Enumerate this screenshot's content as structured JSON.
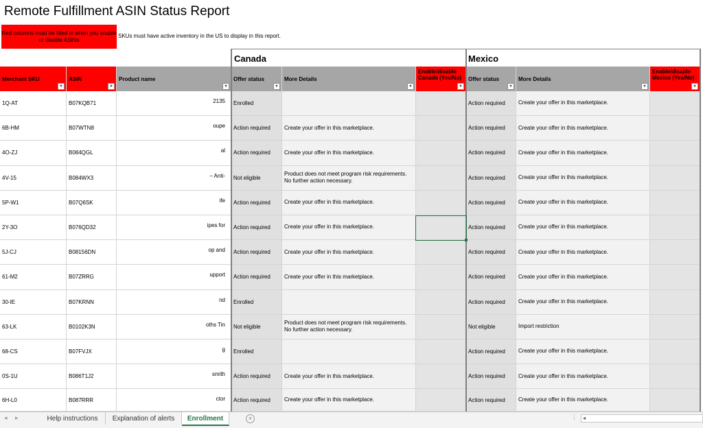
{
  "report": {
    "title": "Remote Fulfillment ASIN Status Report",
    "red_note": "Red columns must be filled in when you enable or disable ASINs",
    "note": "SKUs must have active inventory in the US to display in this report."
  },
  "sections": {
    "canada": "Canada",
    "mexico": "Mexico"
  },
  "headers": {
    "merchant_sku": "Merchant SKU",
    "asin": "ASIN",
    "product_name": "Product name",
    "ca_offer_status": "Offer status",
    "ca_more_details": "More Details",
    "ca_enable": "Enable/disable Canada (Yes/No)",
    "mx_offer_status": "Offer status",
    "mx_more_details": "More Details",
    "mx_enable": "Enable/disable Mexico (Yes/No)"
  },
  "dropdown_glyph": "▾",
  "rows": [
    {
      "sku": "1Q-AT",
      "asin": "B07KQB71",
      "name": "2135",
      "ca_status": "Enrolled",
      "ca_details": "",
      "mx_status": "Action required",
      "mx_details": "Create your offer in this marketplace."
    },
    {
      "sku": "6B-HM",
      "asin": "B07WTN8",
      "name": "oupe",
      "ca_status": "Action required",
      "ca_details": "Create your offer in this marketplace.",
      "mx_status": "Action required",
      "mx_details": "Create your offer in this marketplace."
    },
    {
      "sku": "4O-ZJ",
      "asin": "B084QGL",
      "name": "al",
      "ca_status": "Action required",
      "ca_details": "Create your offer in this marketplace.",
      "mx_status": "Action required",
      "mx_details": "Create your offer in this marketplace."
    },
    {
      "sku": "4V-15",
      "asin": "B084WX3",
      "name": "– Anti-",
      "ca_status": "Not eligible",
      "ca_details": "Product does not meet program risk requirements. No further action necessary.",
      "mx_status": "Action required",
      "mx_details": "Create your offer in this marketplace."
    },
    {
      "sku": "5P-W1",
      "asin": "B07Q6SK",
      "name": "ife",
      "ca_status": "Action required",
      "ca_details": "Create your offer in this marketplace.",
      "mx_status": "Action required",
      "mx_details": "Create your offer in this marketplace."
    },
    {
      "sku": "2Y-3O",
      "asin": "B076QD32",
      "name": "ipes for",
      "ca_status": "Action required",
      "ca_details": "Create your offer in this marketplace.",
      "mx_status": "Action required",
      "mx_details": "Create your offer in this marketplace."
    },
    {
      "sku": "5J-CJ",
      "asin": "B08156DN",
      "name": "op and",
      "ca_status": "Action required",
      "ca_details": "Create your offer in this marketplace.",
      "mx_status": "Action required",
      "mx_details": "Create your offer in this marketplace."
    },
    {
      "sku": "61-M2",
      "asin": "B07ZRRG",
      "name": "upport",
      "ca_status": "Action required",
      "ca_details": "Create your offer in this marketplace.",
      "mx_status": "Action required",
      "mx_details": "Create your offer in this marketplace."
    },
    {
      "sku": "30-IE",
      "asin": "B07KRNN",
      "name": "nd",
      "ca_status": "Enrolled",
      "ca_details": "",
      "mx_status": "Action required",
      "mx_details": "Create your offer in this marketplace."
    },
    {
      "sku": "63-LK",
      "asin": "B0102K3N",
      "name": "oths Tin",
      "ca_status": "Not eligible",
      "ca_details": "Product does not meet program risk requirements. No further action necessary.",
      "mx_status": "Not eligible",
      "mx_details": "Import restriction"
    },
    {
      "sku": "68-CS",
      "asin": "B07FVJX",
      "name": "g",
      "ca_status": "Enrolled",
      "ca_details": "",
      "mx_status": "Action required",
      "mx_details": "Create your offer in this marketplace."
    },
    {
      "sku": "0S-1U",
      "asin": "B086T1J2",
      "name": "smith",
      "ca_status": "Action required",
      "ca_details": "Create your offer in this marketplace.",
      "mx_status": "Action required",
      "mx_details": "Create your offer in this marketplace."
    },
    {
      "sku": "6H-L0",
      "asin": "B087RRR",
      "name": "ctor",
      "ca_status": "Action required",
      "ca_details": "Create your offer in this marketplace.",
      "mx_status": "Action required",
      "mx_details": "Create your offer in this marketplace."
    }
  ],
  "tabs": [
    {
      "label": "Help instructions",
      "active": false
    },
    {
      "label": "Explanation of alerts",
      "active": false
    },
    {
      "label": "Enrollment",
      "active": true
    }
  ],
  "tabbar": {
    "prev": "◂",
    "next": "▸",
    "add": "+",
    "dots": "⋮",
    "scroll_left": "◂"
  }
}
